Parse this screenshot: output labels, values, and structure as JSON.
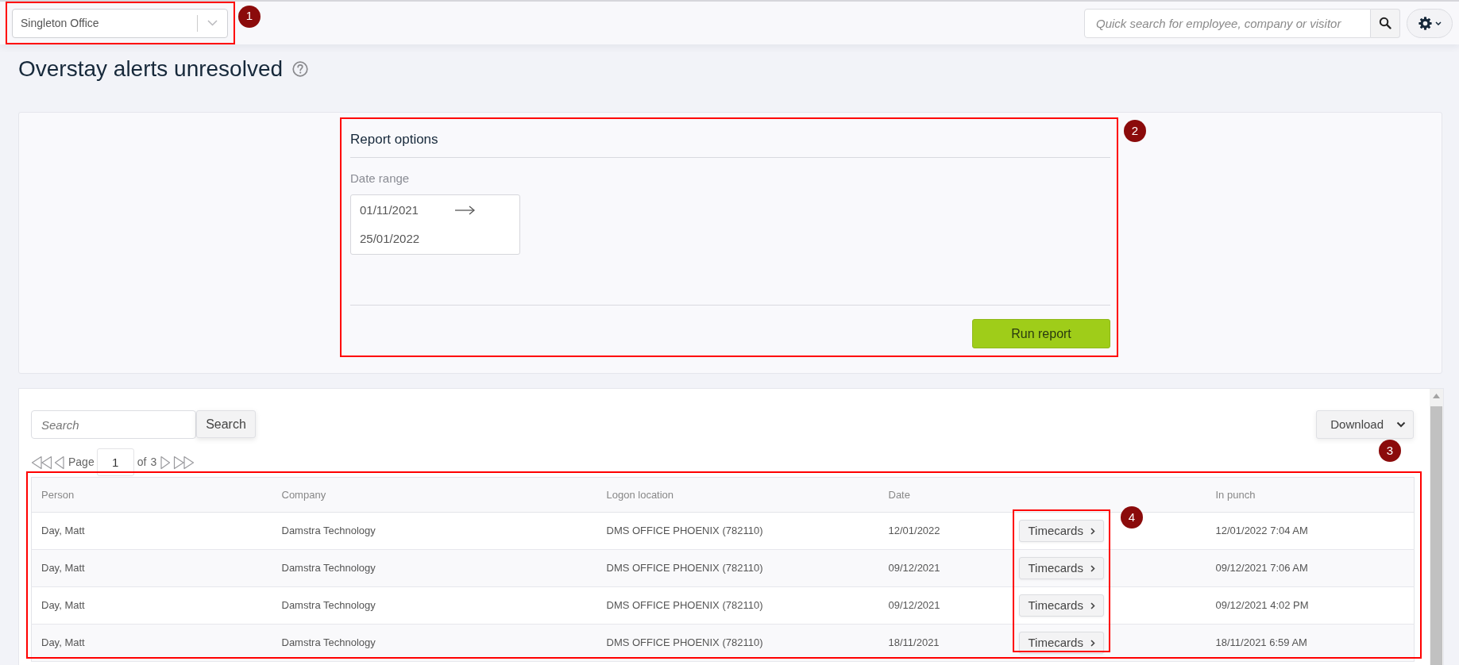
{
  "top_bar": {
    "location_select": {
      "value": "Singleton Office"
    },
    "quick_search": {
      "placeholder": "Quick search for employee, company or visitor"
    }
  },
  "page": {
    "title": "Overstay alerts unresolved"
  },
  "report_options": {
    "title": "Report options",
    "date_range": {
      "label": "Date range",
      "start": "01/11/2021",
      "end": "25/01/2022"
    },
    "run_button": {
      "label": "Run report"
    }
  },
  "results": {
    "search": {
      "placeholder": "Search",
      "button": "Search"
    },
    "download_button": {
      "label": "Download"
    },
    "pager": {
      "label": "Page",
      "page": "1",
      "of_label": "of",
      "total": "3"
    },
    "table": {
      "columns": [
        {
          "kind": "text",
          "label": "Person"
        },
        {
          "kind": "text",
          "label": "Company"
        },
        {
          "kind": "text",
          "label": "Logon location"
        },
        {
          "kind": "text",
          "label": "Date"
        },
        {
          "kind": "action"
        },
        {
          "kind": "text",
          "label": "In punch"
        }
      ],
      "rows": [
        [
          "Day, Matt",
          "Damstra Technology",
          "DMS OFFICE PHOENIX (782110)",
          "12/01/2022",
          "Timecards",
          "12/01/2022 7:04 AM"
        ],
        [
          "Day, Matt",
          "Damstra Technology",
          "DMS OFFICE PHOENIX (782110)",
          "09/12/2021",
          "Timecards",
          "09/12/2021 7:06 AM"
        ],
        [
          "Day, Matt",
          "Damstra Technology",
          "DMS OFFICE PHOENIX (782110)",
          "09/12/2021",
          "Timecards",
          "09/12/2021 4:02 PM"
        ],
        [
          "Day, Matt",
          "Damstra Technology",
          "DMS OFFICE PHOENIX (782110)",
          "18/11/2021",
          "Timecards",
          "18/11/2021 6:59 AM"
        ]
      ]
    }
  },
  "annotations": [
    {
      "number": "1"
    },
    {
      "number": "2"
    },
    {
      "number": "3"
    },
    {
      "number": "4"
    }
  ]
}
